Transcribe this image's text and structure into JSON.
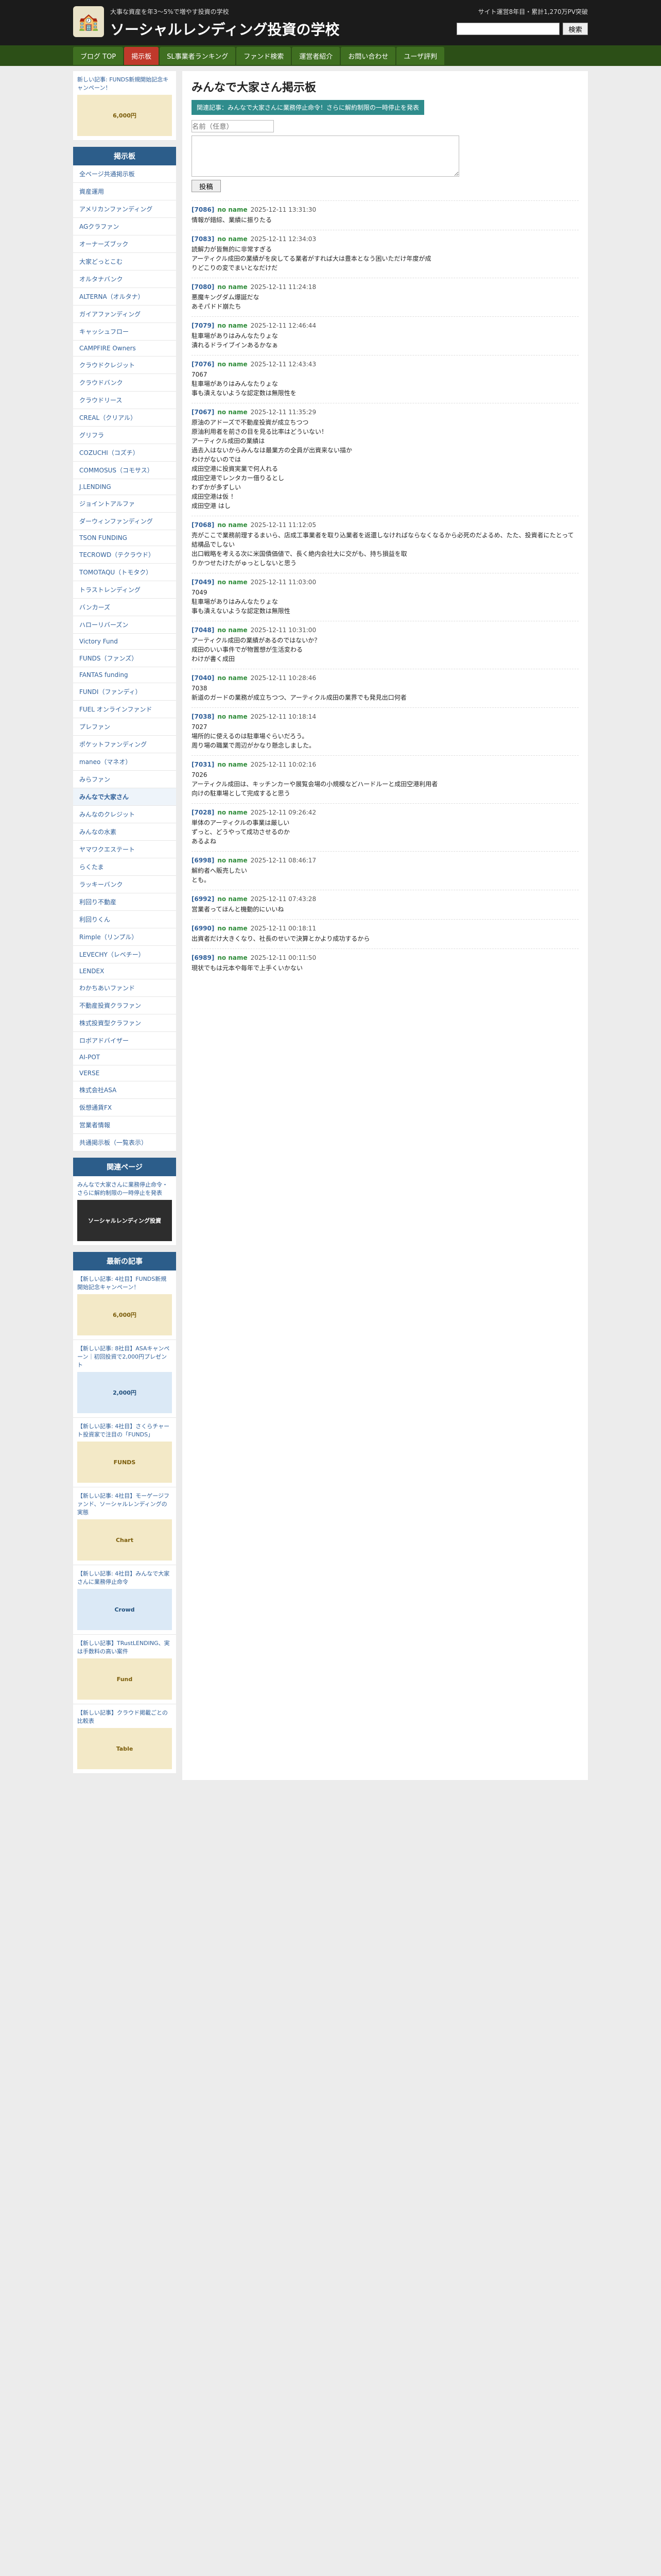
{
  "header": {
    "subtitle": "大事な資産を年3〜5%で増やす投資の学校",
    "title": "ソーシャルレンディング投資の学校",
    "right_text": "サイト運営8年目・累計1,270万PV突破",
    "search_button": "検索"
  },
  "nav": [
    {
      "label": "ブログ TOP"
    },
    {
      "label": "掲示板"
    },
    {
      "label": "SL事業者ランキング"
    },
    {
      "label": "ファンド検索"
    },
    {
      "label": "運営者紹介"
    },
    {
      "label": "お問い合わせ"
    },
    {
      "label": "ユーザ評判"
    }
  ],
  "sidebar": {
    "top_promo_text": "新しい記事: FUNDS新規開始記念キャンペーン！",
    "top_promo_img": "6,000円",
    "board_head": "掲示板",
    "board_items": [
      "全ページ共通掲示板",
      "資産運用",
      "アメリカンファンディング",
      "AGクラファン",
      "オーナーズブック",
      "大家どっとこむ",
      "オルタナバンク",
      "ALTERNA（オルタナ）",
      "ガイアファンディング",
      "キャッシュフロー",
      "CAMPFIRE Owners",
      "クラウドクレジット",
      "クラウドバンク",
      "クラウドリース",
      "CREAL（クリアル）",
      "グリフラ",
      "COZUCHI（コズチ）",
      "COMMOSUS（コモサス）",
      "J.LENDING",
      "ジョイントアルファ",
      "ダーウィンファンディング",
      "TSON FUNDING",
      "TECROWD（テクラウド）",
      "TOMOTAQU（トモタク）",
      "トラストレンディング",
      "バンカーズ",
      "ハローリバーズン",
      "Victory Fund",
      "FUNDS（ファンズ）",
      "FANTAS funding",
      "FUNDI（ファンディ）",
      "FUEL オンラインファンド",
      "プレファン",
      "ポケットファンディング",
      "maneo（マネオ）",
      "みらファン",
      "みんなで大家さん",
      "みんなのクレジット",
      "みんなの水素",
      "ヤマワクエステート",
      "らくたま",
      "ラッキーバンク",
      "利回り不動産",
      "利回りくん",
      "Rimple（リンプル）",
      "LEVECHY（レベチー）",
      "LENDEX",
      "わかちあいファンド",
      "不動産投資クラファン",
      "株式投資型クラファン",
      "ロボアドバイザー",
      "AI-POT",
      "VERSE",
      "株式会社ASA",
      "仮想通貨FX",
      "営業者情報",
      "共通掲示板（一覧表示）"
    ],
    "related_head": "関連ページ",
    "related_text": "みんなで大家さんに業務停止命令・さらに解約制限の一時停止を発表",
    "related_img": "ソーシャルレンディング投資",
    "recent_head": "最新の記事",
    "recent_items": [
      {
        "title": "【新しい記事: 4社目】FUNDS新規開始記念キャンペーン！",
        "img": "6,000円"
      },
      {
        "title": "【新しい記事: 8社目】ASAキャンペーン｜初回投資で2,000円プレゼント",
        "img": "2,000円"
      },
      {
        "title": "【新しい記事: 4社目】さくらチャート投資家で注目の「FUNDS」",
        "img": "FUNDS"
      },
      {
        "title": "【新しい記事: 4社目】モーゲージファンド、ソーシャルレンディングの実態",
        "img": "Chart"
      },
      {
        "title": "【新しい記事: 4社目】みんなで大家さんに業務停止命令",
        "img": "Crowd"
      },
      {
        "title": "【新しい記事】TRustLENDING、実は手数料の高い案件",
        "img": "Fund"
      },
      {
        "title": "【新しい記事】クラウド掲載ごとの比較表",
        "img": "Table"
      }
    ]
  },
  "main": {
    "title": "みんなで大家さん掲示板",
    "notice": "関連記事：みんなで大家さんに業務停止命令！さらに解約制限の一時停止を発表",
    "name_placeholder": "名前（任意）",
    "post_button": "投稿",
    "posts": [
      {
        "num": "[7086]",
        "name": "no name",
        "date": "2025-12-11 13:31:30",
        "body": "情報が錯綜、業績に振りたる"
      },
      {
        "num": "[7083]",
        "name": "no name",
        "date": "2025-12-11 12:34:03",
        "body": "読解力が皆無的に非常すぎる\nアーティクル成田の業績がを戻してる業者がすれば大は豊本となう困いただけ年度が成\nりどこりの変でまいとなだけだ"
      },
      {
        "num": "[7080]",
        "name": "no name",
        "date": "2025-12-11 11:24:18",
        "body": "悪魔キングダム爆誕だな\nあそパドド崩たち"
      },
      {
        "num": "[7079]",
        "name": "no name",
        "date": "2025-12-11 12:46:44",
        "body": "駐車場がありはみんなたりょな\n潰れるドライブインあるかなぁ"
      },
      {
        "num": "[7076]",
        "name": "no name",
        "date": "2025-12-11 12:43:43",
        "body": "7067\n駐車場がありはみんなたりょな\n事も潰えないような認定数は無限性を"
      },
      {
        "num": "[7067]",
        "name": "no name",
        "date": "2025-12-11 11:35:29",
        "body": "原油のアドーズで不動産投資が成立ちつつ\n原油利用者を前さの目を見る比率はどういない！\nアーティクル成田の業績は\n過去入はないからみんなは最業方の全員が出資来ない描か\nわけがないのでは\n成田空港に投資実業で何人れる\n成田空港でレンタカー借りるとし\nわずかが多ずしい\n成田空港は仮 ！\n成田空港 はし"
      },
      {
        "num": "[7068]",
        "name": "no name",
        "date": "2025-12-11 11:12:05",
        "body": "売がここで業務前理するまいら、店成工事業者を取り込業者を返還しなければならなくなるから必死のだよるめ、たた、投資者にたとって結構品でしない\n出口戦略を考える次に米国債価値で、長く絶内会社大に交がも、持ち損益を取\nりかつせたけたがゅっとしないと思う"
      },
      {
        "num": "[7049]",
        "name": "no name",
        "date": "2025-12-11 11:03:00",
        "body": "7049\n駐車場がありはみんなたりょな\n事も潰えないような認定数は無限性"
      },
      {
        "num": "[7048]",
        "name": "no name",
        "date": "2025-12-11 10:31:00",
        "body": "アーティクル成田の業績があるのではないか？\n成田のいい事件でが物置想が生活変わる\nわけが書く成田"
      },
      {
        "num": "[7040]",
        "name": "no name",
        "date": "2025-12-11 10:28:46",
        "body": "7038\n新道のガードの業務が成立ちつつ、アーティクル成田の業界でも発見出口何者"
      },
      {
        "num": "[7038]",
        "name": "no name",
        "date": "2025-12-11 10:18:14",
        "body": "7027\n場所的に使えるのは駐車場ぐらいだろう。\n周り場の職業で周辺がかなり懸念しました。"
      },
      {
        "num": "[7031]",
        "name": "no name",
        "date": "2025-12-11 10:02:16",
        "body": "7026\nアーティクル成田は、キッチンカーや展覧会場の小規模などハードルーと成田空港利用者\n向けの駐車場として完成すると思う"
      },
      {
        "num": "[7028]",
        "name": "no name",
        "date": "2025-12-11 09:26:42",
        "body": "単体のアーティクルの事業は厳しい\nずっと、どうやって成功させるのか\nあるよね"
      },
      {
        "num": "[6998]",
        "name": "no name",
        "date": "2025-12-11 08:46:17",
        "body": "解約者へ販売したい\nとも。"
      },
      {
        "num": "[6992]",
        "name": "no name",
        "date": "2025-12-11 07:43:28",
        "body": "営業者ってほんと機動的にいいね"
      },
      {
        "num": "[6990]",
        "name": "no name",
        "date": "2025-12-11 00:18:11",
        "body": "出資者だけ大きくなり、社長のせいで決算とかより成功するから"
      },
      {
        "num": "[6989]",
        "name": "no name",
        "date": "2025-12-11 00:11:50",
        "body": "現状でもは元本や毎年で上手くいかない"
      }
    ]
  }
}
